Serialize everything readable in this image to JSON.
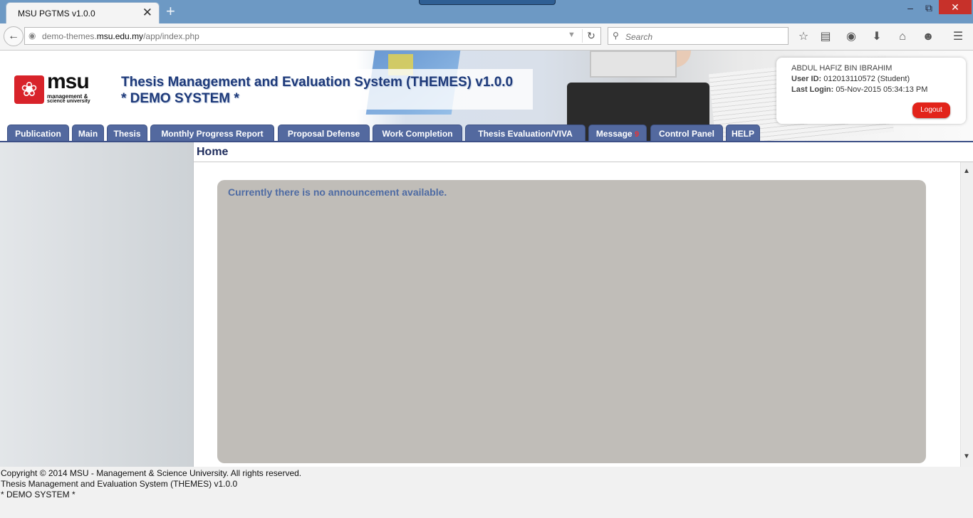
{
  "browser": {
    "tab_title": "MSU PGTMS v1.0.0",
    "tab_close": "✕",
    "new_tab": "+",
    "url_prefix": "demo-themes.",
    "url_domain": "msu.edu.my",
    "url_path": "/app/index.php",
    "search_placeholder": "Search"
  },
  "header": {
    "logo_text": "msu",
    "logo_sub1": "management &",
    "logo_sub2": "science university",
    "title": "Thesis Management and Evaluation System (THEMES) v1.0.0",
    "subtitle": "* DEMO SYSTEM *"
  },
  "user": {
    "name": "ABDUL HAFIZ BIN IBRAHIM",
    "id_label": "User ID:",
    "id_value": "012013110572 (Student)",
    "last_login_label": "Last Login:",
    "last_login_value": "05-Nov-2015 05:34:13 PM",
    "logout_label": "Logout"
  },
  "menu": {
    "items": [
      {
        "label": "Publication"
      },
      {
        "label": "Main"
      },
      {
        "label": "Thesis"
      },
      {
        "label": "Monthly Progress Report"
      },
      {
        "label": "Proposal Defense"
      },
      {
        "label": "Work Completion"
      },
      {
        "label": "Thesis Evaluation/VIVA"
      },
      {
        "label": "Message",
        "badge": "9"
      },
      {
        "label": "Control Panel"
      },
      {
        "label": "HELP"
      }
    ]
  },
  "page": {
    "title": "Home",
    "announcement": "Currently there is no announcement available."
  },
  "footer": {
    "line1": "Copyright © 2014 MSU - Management & Science University. All rights reserved.",
    "line2": "Thesis Management and Evaluation System (THEMES) v1.0.0",
    "line3": "* DEMO SYSTEM *"
  }
}
